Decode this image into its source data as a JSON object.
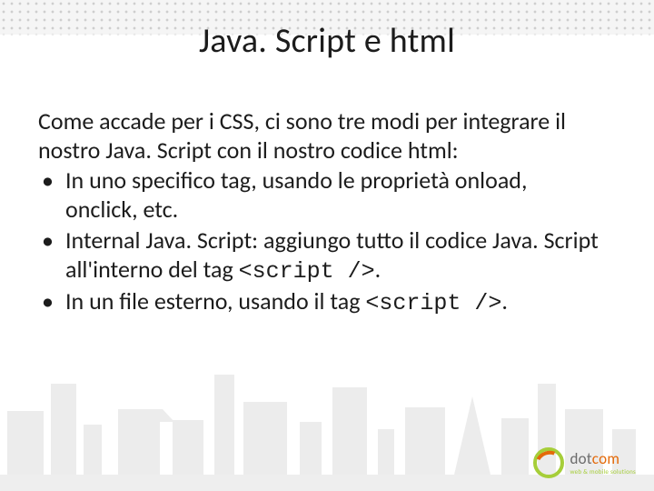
{
  "title": "Java. Script e html",
  "intro": "Come accade per i CSS, ci sono tre modi per integrare il nostro Java. Script con il nostro codice html:",
  "bullets": [
    {
      "text": "In uno specifico tag, usando le proprietà onload, onclick, etc."
    },
    {
      "prefix": "Internal Java. Script: aggiungo tutto il codice Java. Script all'interno del tag ",
      "code": "<script />",
      "suffix": "."
    },
    {
      "prefix": "In un file esterno, usando il tag ",
      "code": "<script />",
      "suffix": "."
    }
  ],
  "logo": {
    "word_prefix": "dot",
    "word_accent": "com",
    "tagline": "web & mobile solutions"
  }
}
